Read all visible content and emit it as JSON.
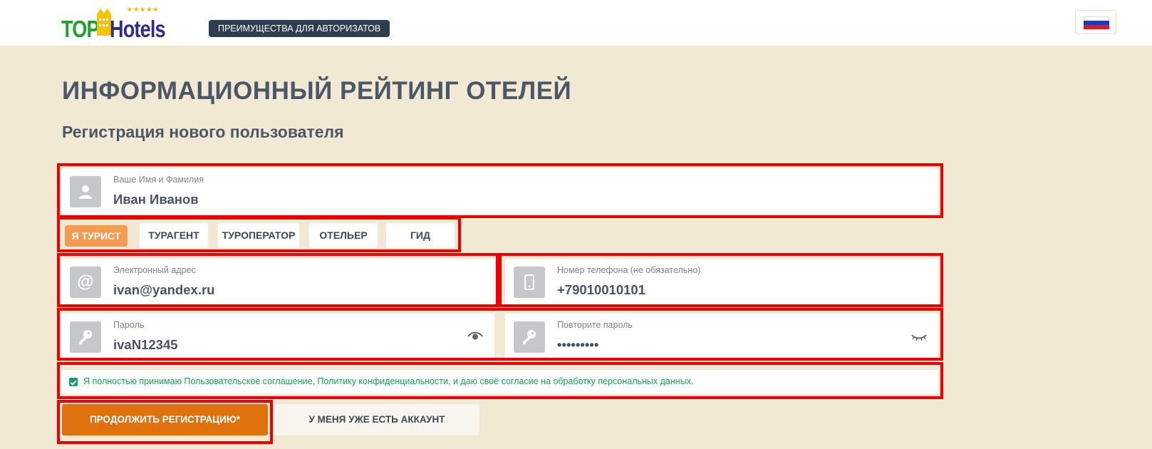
{
  "header": {
    "logo_text_top": "TOP",
    "logo_text_hotels": "Hotels",
    "logo_stars": "★★★★★",
    "perks_button": "ПРЕИМУЩЕСТВА ДЛЯ АВТОРИЗАТОВ",
    "language_flag": "russia-flag-icon"
  },
  "main": {
    "title": "ИНФОРМАЦИОННЫЙ РЕЙТИНГ ОТЕЛЕЙ",
    "subtitle": "Регистрация нового пользователя"
  },
  "form": {
    "name": {
      "label": "Ваше Имя и Фамилия",
      "value": "Иван Иванов",
      "icon": "user-icon"
    },
    "roles": [
      {
        "label": "Я ТУРИСТ",
        "selected": true
      },
      {
        "label": "ТУРАГЕНТ",
        "selected": false
      },
      {
        "label": "ТУРОПЕРАТОР",
        "selected": false
      },
      {
        "label": "ОТЕЛЬЕР",
        "selected": false
      },
      {
        "label": "ГИД",
        "selected": false
      }
    ],
    "email": {
      "label": "Электронный адрес",
      "value": "ivan@yandex.ru",
      "icon": "at-icon"
    },
    "phone": {
      "label": "Номер телефона (не обязательно)",
      "value": "+79010010101",
      "icon": "phone-icon"
    },
    "password": {
      "label": "Пароль",
      "value": "ivaN12345",
      "icon": "key-icon",
      "toggle": "eye-open-icon"
    },
    "password_repeat": {
      "label": "Повторите пароль",
      "value": "•••••••••",
      "icon": "key-icon",
      "toggle": "eye-closed-icon"
    },
    "agreement": {
      "checked": true,
      "text": "Я полностью принимаю Пользовательское соглашение, Политику конфиденциальности, и даю своё согласие на обработку персональных данных."
    },
    "continue_button": "ПРОДОЛЖИТЬ РЕГИСТРАЦИЮ*",
    "have_account_button": "У МЕНЯ УЖЕ ЕСТЬ АККАУНТ"
  },
  "colors": {
    "background": "#f1e9d3",
    "accent_orange": "#e0720d",
    "role_active": "#f39b50",
    "highlight_red": "#ee0000",
    "agreement_green": "#16a05a"
  }
}
